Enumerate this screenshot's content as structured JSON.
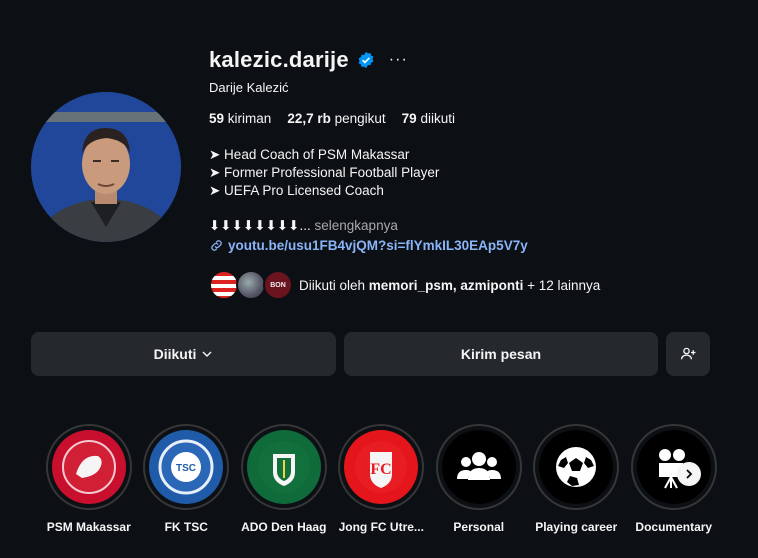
{
  "profile": {
    "username": "kalezic.darije",
    "full_name": "Darije Kalezić",
    "verified_icon": "verified-badge-icon",
    "more_label": "···"
  },
  "stats": {
    "posts_value": "59",
    "posts_label": "kiriman",
    "followers_value": "22,7 rb",
    "followers_label": "pengikut",
    "following_value": "79",
    "following_label": "diikuti"
  },
  "bio": {
    "lines": [
      "➤ Head Coach of PSM Makassar",
      "➤ Former Professional Football Player",
      "➤ UEFA Pro Licensed Coach"
    ],
    "arrows": "⬇⬇⬇⬇⬇⬇⬇⬇...",
    "more": "selengkapnya",
    "link": "youtu.be/usu1FB4vjQM?si=flYmkIL30EAp5V7y"
  },
  "followed_by": {
    "prefix": "Diikuti oleh",
    "names": "memori_psm, azmiponti",
    "suffix": "+ 12 lainnya",
    "mini_badge_text": "BON"
  },
  "buttons": {
    "following": "Diikuti",
    "message": "Kirim pesan"
  },
  "highlights": [
    {
      "label": "PSM Makassar",
      "color": "#c8102e"
    },
    {
      "label": "FK TSC",
      "color": "#1f5ba8"
    },
    {
      "label": "ADO Den Haag",
      "color": "#0f6b3a"
    },
    {
      "label": "Jong FC Utre...",
      "color": "#e4161b"
    },
    {
      "label": "Personal",
      "color": "#000000"
    },
    {
      "label": "Playing career",
      "color": "#000000"
    },
    {
      "label": "Documentary",
      "color": "#000000"
    }
  ]
}
